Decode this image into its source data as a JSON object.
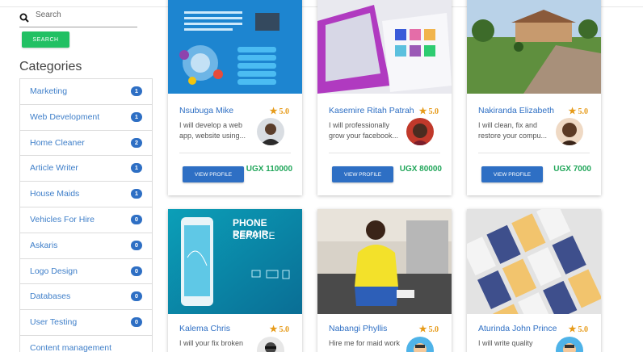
{
  "search": {
    "placeholder": "Search",
    "button_label": "SEARCH"
  },
  "sidebar": {
    "title": "Categories",
    "items": [
      {
        "label": "Marketing",
        "count": "1"
      },
      {
        "label": "Web Development",
        "count": "1"
      },
      {
        "label": "Home Cleaner",
        "count": "2"
      },
      {
        "label": "Article Writer",
        "count": "1"
      },
      {
        "label": "House Maids",
        "count": "1"
      },
      {
        "label": "Vehicles For Hire",
        "count": "0"
      },
      {
        "label": "Askaris",
        "count": "0"
      },
      {
        "label": "Logo Design",
        "count": "0"
      },
      {
        "label": "Databases",
        "count": "0"
      },
      {
        "label": "User Testing",
        "count": "0"
      },
      {
        "label": "Content management",
        "count": ""
      }
    ]
  },
  "cards": [
    {
      "name": "Nsubuga Mike",
      "rating": "5.0",
      "desc_line1": "I will develop a web",
      "desc_line2": "app, website using...",
      "button": "VIEW PROFILE",
      "price": "UGX 110000"
    },
    {
      "name": "Kasemire Ritah Patrah",
      "rating": "5.0",
      "desc_line1": "I will professionally",
      "desc_line2": "grow your facebook...",
      "button": "VIEW PROFILE",
      "price": "UGX 80000"
    },
    {
      "name": "Nakiranda Elizabeth",
      "rating": "5.0",
      "desc_line1": "I will clean, fix and",
      "desc_line2": "restore your compu...",
      "button": "VIEW PROFILE",
      "price": "UGX 7000"
    },
    {
      "name": "Kalema Chris",
      "rating": "5.0",
      "desc_line1": "I will your fix broken",
      "image_title": "PHONE REPAIR",
      "image_subtitle": "SERVICE"
    },
    {
      "name": "Nabangi Phyllis",
      "rating": "5.0",
      "desc_line1": "Hire me for maid work"
    },
    {
      "name": "Aturinda John Prince",
      "rating": "5.0",
      "desc_line1": "I will write quality"
    }
  ],
  "colors": {
    "primary": "#2e6fc4",
    "success": "#21c063",
    "star": "#e69a18",
    "price": "#21a65a"
  }
}
